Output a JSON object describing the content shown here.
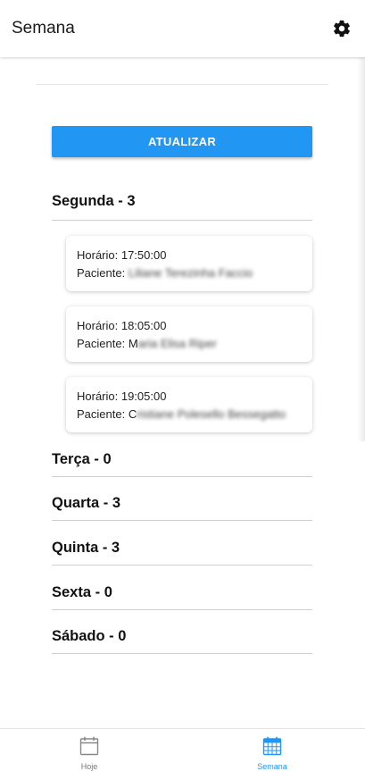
{
  "header": {
    "title": "Semana",
    "settings_icon": "gear-icon"
  },
  "update_button": {
    "label": "ATUALIZAR",
    "color": "#2196f3"
  },
  "days": [
    {
      "label": "Segunda - 3"
    },
    {
      "label": "Terça - 0"
    },
    {
      "label": "Quarta - 3"
    },
    {
      "label": "Quinta - 3"
    },
    {
      "label": "Sexta - 0"
    },
    {
      "label": "Sábado - 0"
    }
  ],
  "appointments": [
    {
      "time": "Horário: 17:50:00",
      "patient_prefix": "Paciente: ",
      "patient_name": "Liliane Terezinha Faccio"
    },
    {
      "time": "Horário: 18:05:00",
      "patient_prefix": "Paciente: M",
      "patient_name": "aria Elisa Riper"
    },
    {
      "time": "Horário: 19:05:00",
      "patient_prefix": "Paciente: C",
      "patient_name": "ristiane Polesello Bessegatto"
    }
  ],
  "bottom_nav": {
    "items": [
      {
        "label": "Hoje",
        "icon": "calendar-icon",
        "active": false
      },
      {
        "label": "Semana",
        "icon": "calendar-grid-icon",
        "active": true
      }
    ],
    "active_color": "#2196f3",
    "inactive_color": "#777777"
  }
}
